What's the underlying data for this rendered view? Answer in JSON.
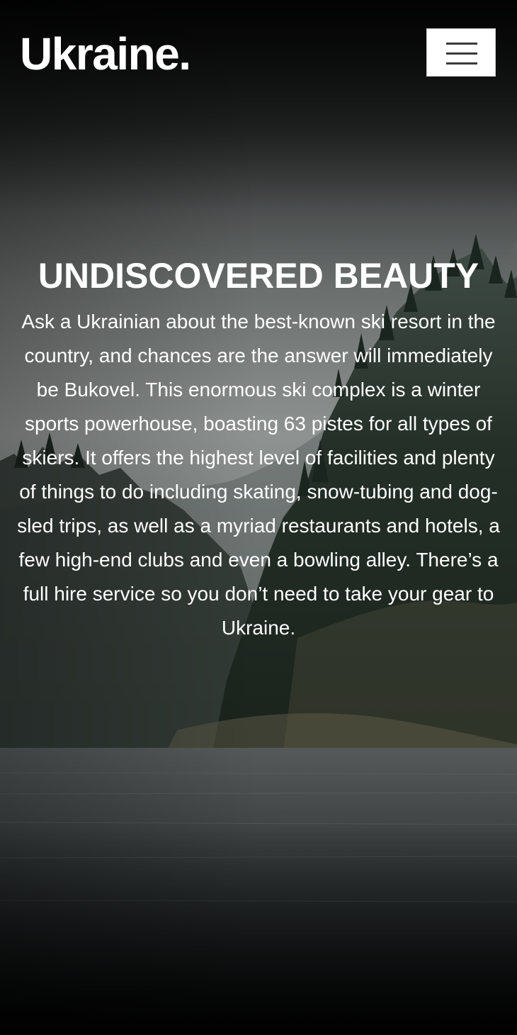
{
  "brand": {
    "logo_text": "Ukraine."
  },
  "header": {
    "menu_icon": "hamburger-menu-icon"
  },
  "hero": {
    "title": "UNDISCOVERED BEAUTY",
    "body": "Ask a Ukrainian about the best-known ski resort in the country, and chances are the answer will immediately be Bukovel. This enormous ski complex is a winter sports powerhouse, boasting 63 pistes for all types of skiers. It offers the highest level of facilities and plenty of things to do including skating, snow-tubing and dog-sled trips, as well as a myriad restaurants and hotels, a few high-end clubs and even a bowling alley. There’s a full hire service so you don’t need to take your gear to Ukraine."
  },
  "background": {
    "description_colors": {
      "sky": "#2b2d2d",
      "mist": "#8a8f8d",
      "forest": "#1f2b22",
      "water": "#3a3f40"
    }
  }
}
